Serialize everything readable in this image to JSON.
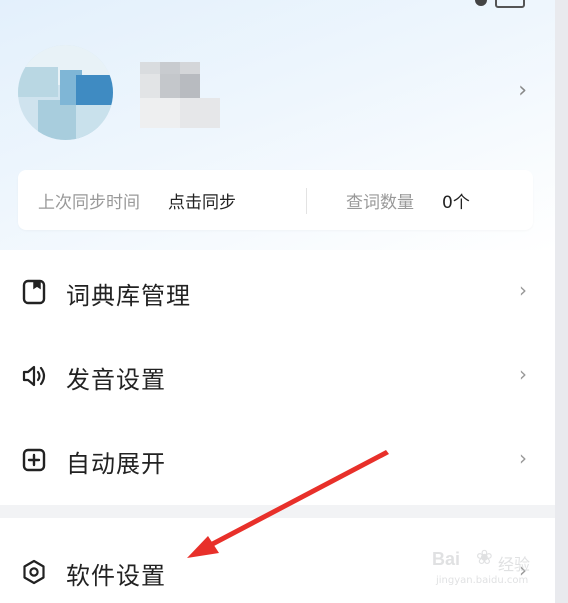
{
  "profile": {
    "chevron": "›"
  },
  "sync": {
    "label": "上次同步时间",
    "action": "点击同步",
    "count_label": "查词数量",
    "count_value": "0个"
  },
  "menu": {
    "items": [
      {
        "label": "词典库管理",
        "icon": "book-icon",
        "chevron": "›"
      },
      {
        "label": "发音设置",
        "icon": "speaker-icon",
        "chevron": "›"
      },
      {
        "label": "自动展开",
        "icon": "plus-square-icon",
        "chevron": "›"
      },
      {
        "label": "软件设置",
        "icon": "settings-hexagon-icon",
        "chevron": "›"
      }
    ]
  },
  "watermark": {
    "brand": "Bai",
    "suffix": "经验",
    "url": "jingyan.baidu.com"
  },
  "colors": {
    "header_gradient_top": "#e3f0fc",
    "annotation_arrow": "#e8302a",
    "text_primary": "#222222",
    "text_secondary": "#999999",
    "section_gap": "#f2f3f5"
  }
}
